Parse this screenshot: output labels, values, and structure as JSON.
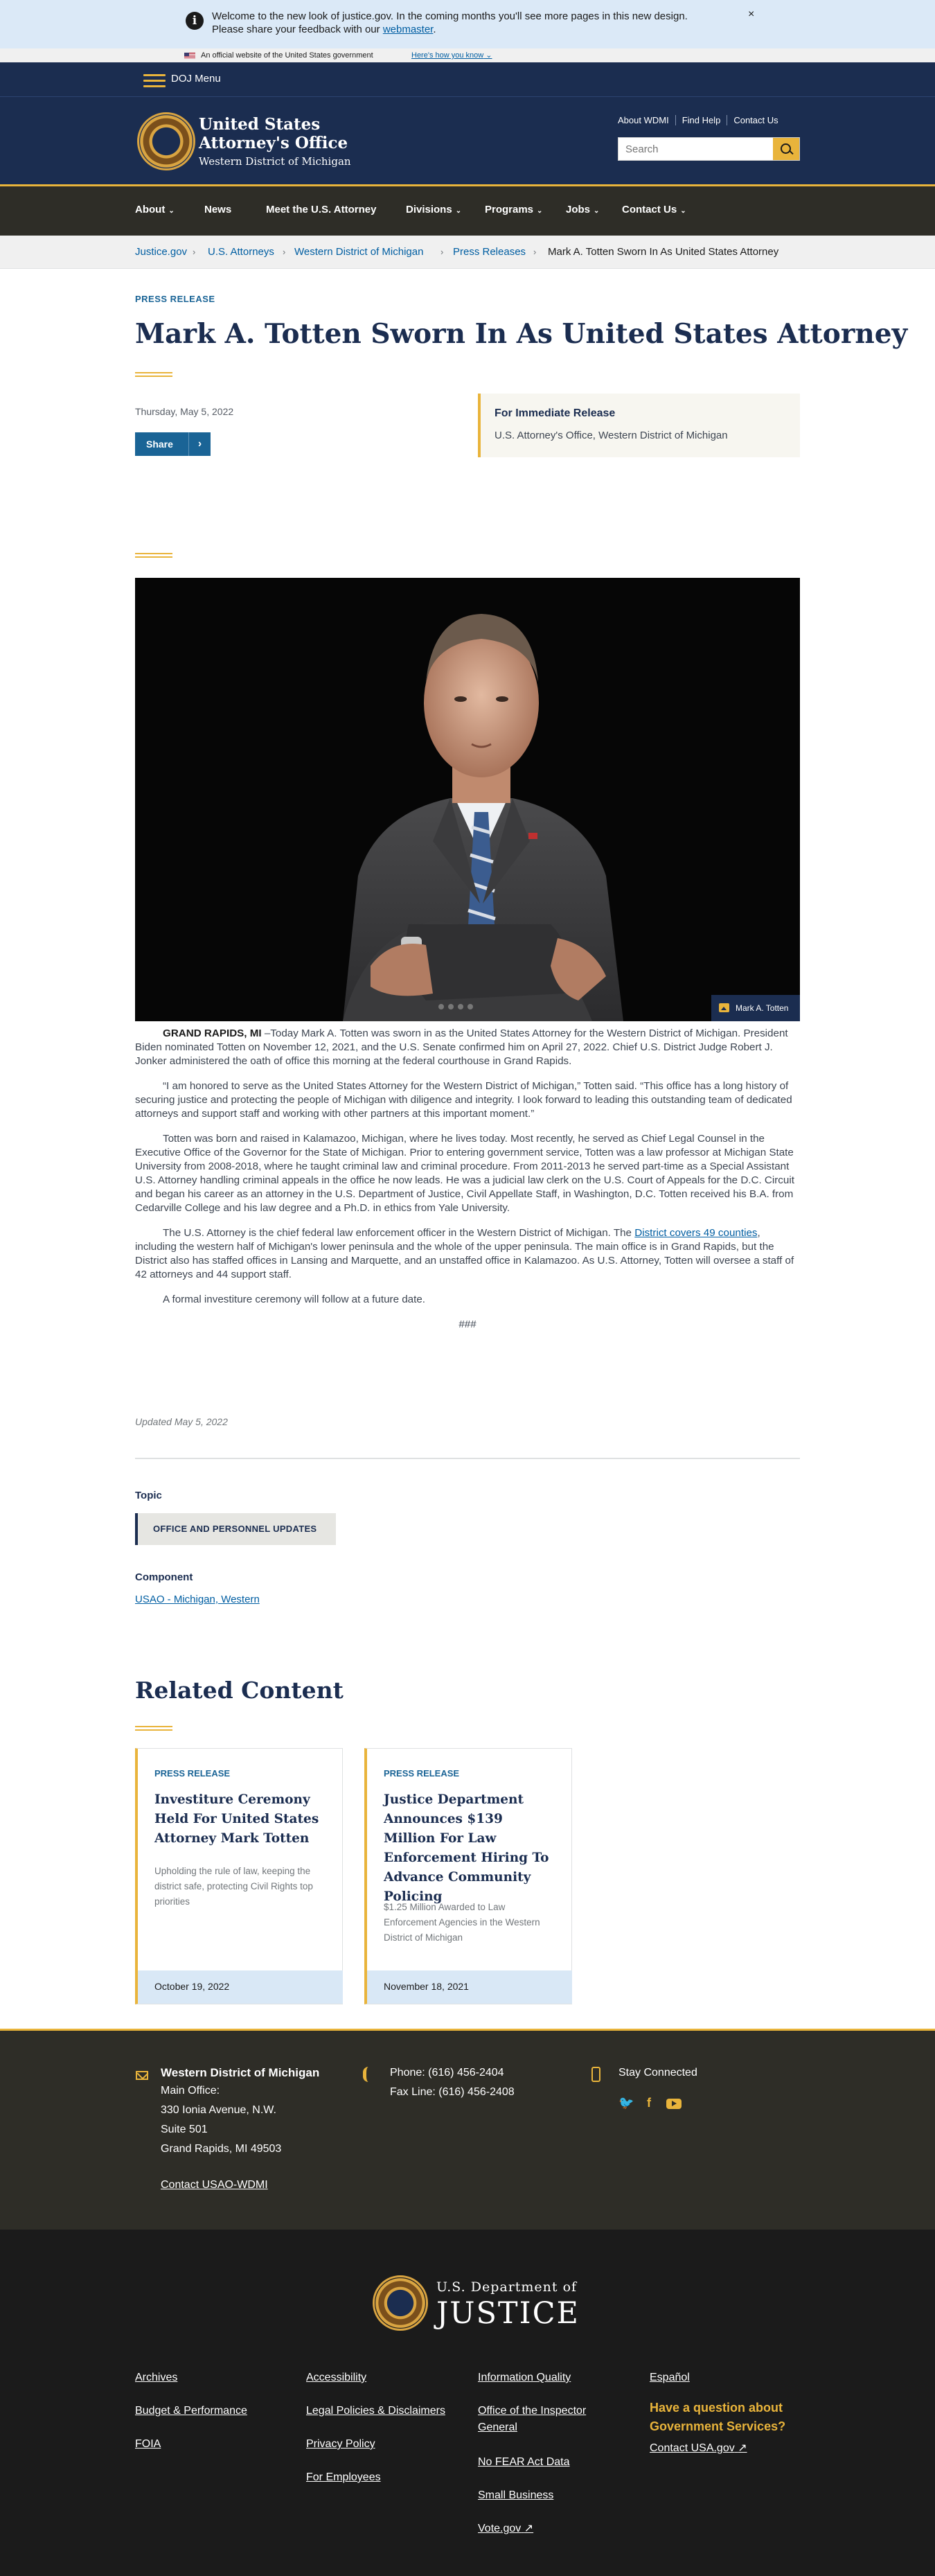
{
  "banner": {
    "message": "Welcome to the new look of justice.gov. In the coming months you'll see more pages in this new design. Please share your feedback with our",
    "link": "webmaster",
    "close": "×"
  },
  "gov_banner": {
    "text": "An official website of the United States government",
    "link": "Here's how you know"
  },
  "doj_menu": {
    "label": "DOJ Menu"
  },
  "header": {
    "title_line1": "United States",
    "title_line2": "Attorney's Office",
    "subtitle": "Western District of Michigan",
    "utility_links": [
      "About WDMI",
      "Find Help",
      "Contact Us"
    ],
    "search_placeholder": "Search"
  },
  "nav": {
    "items": [
      {
        "label": "About",
        "dropdown": true
      },
      {
        "label": "News",
        "dropdown": false
      },
      {
        "label": "Meet the U.S. Attorney",
        "dropdown": false
      },
      {
        "label": "Divisions",
        "dropdown": true
      },
      {
        "label": "Programs",
        "dropdown": true
      },
      {
        "label": "Jobs",
        "dropdown": true
      },
      {
        "label": "Contact Us",
        "dropdown": true
      }
    ]
  },
  "breadcrumb": [
    "Justice.gov",
    "U.S. Attorneys",
    "Western District of Michigan",
    "Press Releases",
    "Mark A. Totten Sworn In As United States Attorney"
  ],
  "article": {
    "eyebrow": "PRESS RELEASE",
    "title": "Mark A. Totten Sworn In As United States Attorney",
    "date": "Thursday, May 5, 2022",
    "share": "Share",
    "release_heading": "For Immediate Release",
    "release_office": "U.S. Attorney's Office, Western District of Michigan",
    "photo_caption": "Mark A. Totten",
    "dateline": "GRAND RAPIDS, MI",
    "p1": " –Today Mark A. Totten was sworn in as the United States Attorney for the Western District of Michigan. President Biden nominated Totten on November 12, 2021, and the U.S. Senate confirmed him on April 27, 2022. Chief U.S. District Judge Robert J. Jonker administered the oath of office this morning at the federal courthouse in Grand Rapids.",
    "p2": "“I am honored to serve as the United States Attorney for the Western District of Michigan,” Totten said. “This office has a long history of securing justice and protecting the people of Michigan with diligence and integrity. I look forward to leading this outstanding team of dedicated attorneys and support staff and working with other partners at this important moment.”",
    "p3": "Totten was born and raised in Kalamazoo, Michigan, where he lives today. Most recently, he served as Chief Legal Counsel in the Executive Office of the Governor for the State of Michigan. Prior to entering government service, Totten was a law professor at Michigan State University from 2008-2018, where he taught criminal law and criminal procedure. From 2011-2013 he served part-time as a Special Assistant U.S. Attorney handling criminal appeals in the office he now leads. He was a judicial law clerk on the U.S. Court of Appeals for the D.C. Circuit and began his career as an attorney in the U.S. Department of Justice, Civil Appellate Staff, in Washington, D.C. Totten received his B.A. from Cedarville College and his law degree and a Ph.D. in ethics from Yale University.",
    "p4_before": "The U.S. Attorney is the chief federal law enforcement officer in the Western District of Michigan. The ",
    "p4_link": "District covers 49 counties",
    "p4_after": ", including the western half of Michigan's lower peninsula and the whole of the upper peninsula. The main office is in Grand Rapids, but the District also has staffed offices in Lansing and Marquette, and an unstaffed office in Kalamazoo. As U.S. Attorney, Totten will oversee a staff of 42 attorneys and 44 support staff.",
    "p5": "A formal investiture ceremony will follow at a future date.",
    "end_mark": "###",
    "updated": "Updated May 5, 2022"
  },
  "topic": {
    "label": "Topic",
    "tag": "OFFICE AND PERSONNEL UPDATES"
  },
  "component": {
    "label": "Component",
    "link": "USAO - Michigan, Western"
  },
  "related": {
    "heading": "Related Content",
    "cards": [
      {
        "eyebrow": "PRESS RELEASE",
        "title": "Investiture Ceremony Held For United States Attorney Mark Totten",
        "desc": "Upholding the rule of law, keeping the district safe, protecting Civil Rights top priorities",
        "date": "October 19, 2022"
      },
      {
        "eyebrow": "PRESS RELEASE",
        "title": "Justice Department Announces $139 Million For Law Enforcement Hiring To Advance Community Policing",
        "desc": "$1.25 Million Awarded to Law Enforcement Agencies in the Western District of Michigan",
        "date": "November 18, 2021"
      }
    ]
  },
  "footer_contact": {
    "name": "Western District of Michigan",
    "main_office": "Main Office:",
    "addr1": "330 Ionia Avenue, N.W.",
    "addr2": "Suite 501",
    "addr3": "Grand Rapids, MI 49503",
    "contact_link": "Contact USAO-WDMI",
    "phone": "Phone: (616) 456-2404",
    "fax": "Fax Line: (616) 456-2408",
    "stay": "Stay Connected"
  },
  "footer_main": {
    "dept_top": "U.S. Department of",
    "dept_big": "JUSTICE",
    "col1": [
      "Archives",
      "Budget & Performance",
      "FOIA"
    ],
    "col2": [
      "Accessibility",
      "Legal Policies & Disclaimers",
      "Privacy Policy",
      "For Employees"
    ],
    "col3": [
      "Information Quality",
      "Office of the Inspector General",
      "No FEAR Act Data",
      "Small Business",
      "Vote.gov"
    ],
    "col4": [
      "Español"
    ],
    "question": "Have a question about Government Services?",
    "contact_usa": "Contact USA.gov"
  },
  "colors": {
    "navy": "#1b2d50",
    "gold": "#e9b43b",
    "link": "#005ea2",
    "dark_footer": "#2e2d27"
  }
}
